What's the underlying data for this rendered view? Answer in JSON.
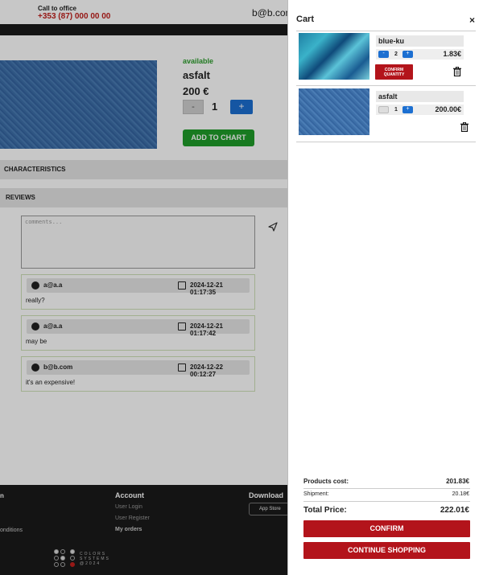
{
  "header": {
    "call_label": "Call to office",
    "phone": "+353 (87) 000 00 00",
    "user_email": "b@b.com"
  },
  "product": {
    "availability": "available",
    "name": "asfalt",
    "price": "200 €",
    "quantity": "1",
    "minus_label": "-",
    "plus_label": "+",
    "add_button": "ADD TO CHART"
  },
  "sections": {
    "characteristics": "CHARACTERISTICS",
    "reviews": "REVIEWS"
  },
  "comment": {
    "placeholder": "comments..."
  },
  "reviews": [
    {
      "user": "a@a.a",
      "date": "2024-12-21 01:17:35",
      "text": "really?"
    },
    {
      "user": "a@a.a",
      "date": "2024-12-21 01:17:42",
      "text": "may be"
    },
    {
      "user": "b@b.com",
      "date": "2024-12-22 00:12:27",
      "text": "it's an expensive!"
    }
  ],
  "footer": {
    "col1_head": "n",
    "col1_link": "onditions",
    "account_head": "Account",
    "account_links": [
      "User Login",
      "User Register",
      "My orders"
    ],
    "download_head": "Download",
    "app_store": "App Store",
    "logo_text": "COLORS SYSTEMS @2024"
  },
  "cart": {
    "title": "Cart",
    "close": "×",
    "items": [
      {
        "name": "blue-ku",
        "qty": "2",
        "price": "1.83€",
        "minus": "-",
        "plus": "+",
        "confirm": "CONFIRM QUANTITY"
      },
      {
        "name": "asfalt",
        "qty": "1",
        "price": "200.00€",
        "minus": "-",
        "plus": "+"
      }
    ],
    "products_cost_label": "Products cost:",
    "products_cost": "201.83€",
    "shipment_label": "Shipment:",
    "shipment": "20.18€",
    "total_label": "Total Price:",
    "total": "222.01€",
    "confirm_button": "CONFIRM",
    "continue_button": "CONTINUE SHOPPING"
  },
  "colors": {
    "accent_red": "#b3141b",
    "accent_blue": "#1c6fd1",
    "accent_green": "#1f9d2a"
  }
}
